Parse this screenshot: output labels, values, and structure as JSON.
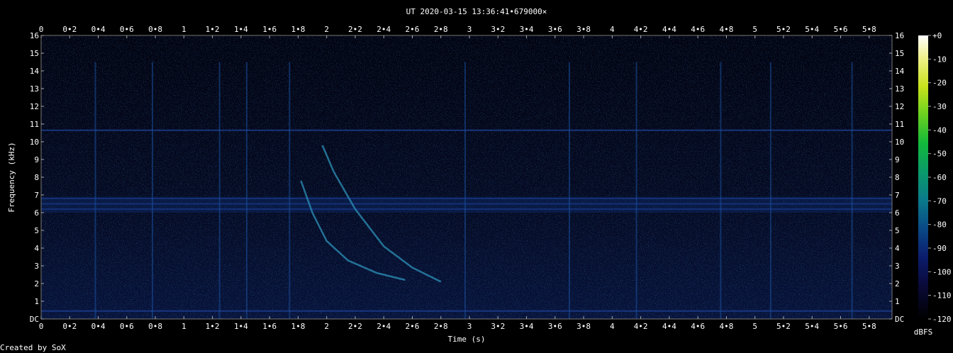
{
  "title": "UT 2020-03-15 13:36:41•679000×",
  "credit": "Created by SoX",
  "colorbar_unit": "dBFS",
  "chart_data": {
    "type": "heatmap",
    "title": "UT 2020-03-15 13:36:41•679000×",
    "xlabel": "Time (s)",
    "ylabel": "Frequency (kHz)",
    "xlim": [
      0,
      5.96
    ],
    "ylim": [
      0,
      16
    ],
    "x_ticks": [
      "0",
      "0•2",
      "0•4",
      "0•6",
      "0•8",
      "1",
      "1•2",
      "1•4",
      "1•6",
      "1•8",
      "2",
      "2•2",
      "2•4",
      "2•6",
      "2•8",
      "3",
      "3•2",
      "3•4",
      "3•6",
      "3•8",
      "4",
      "4•2",
      "4•4",
      "4•6",
      "4•8",
      "5",
      "5•2",
      "5•4",
      "5•6",
      "5•8"
    ],
    "y_ticks": [
      "DC",
      "1",
      "2",
      "3",
      "4",
      "5",
      "6",
      "7",
      "8",
      "9",
      "10",
      "11",
      "12",
      "13",
      "14",
      "15",
      "16"
    ],
    "colorbar": {
      "label": "dBFS",
      "ticks": [
        "+0",
        "-10",
        "-20",
        "-30",
        "-40",
        "-50",
        "-60",
        "-70",
        "-80",
        "-90",
        "-100",
        "-110",
        "-120"
      ],
      "range": [
        -120,
        0
      ]
    },
    "features": {
      "horizontal_lines_khz": [
        10.65,
        6.8,
        6.5,
        6.2,
        0.45
      ],
      "vertical_impulses_s": [
        0.38,
        0.78,
        1.25,
        1.44,
        1.74,
        2.97,
        3.7,
        4.17,
        4.76,
        5.11,
        5.68
      ],
      "whistler_curves": [
        {
          "x": [
            1.97,
            2.05,
            2.2,
            2.4,
            2.6,
            2.8
          ],
          "y_khz": [
            9.8,
            8.3,
            6.2,
            4.1,
            2.9,
            2.1
          ]
        },
        {
          "x": [
            1.82,
            1.9,
            2.0,
            2.15,
            2.35,
            2.55
          ],
          "y_khz": [
            7.8,
            6.0,
            4.4,
            3.3,
            2.6,
            2.2
          ]
        }
      ]
    }
  }
}
